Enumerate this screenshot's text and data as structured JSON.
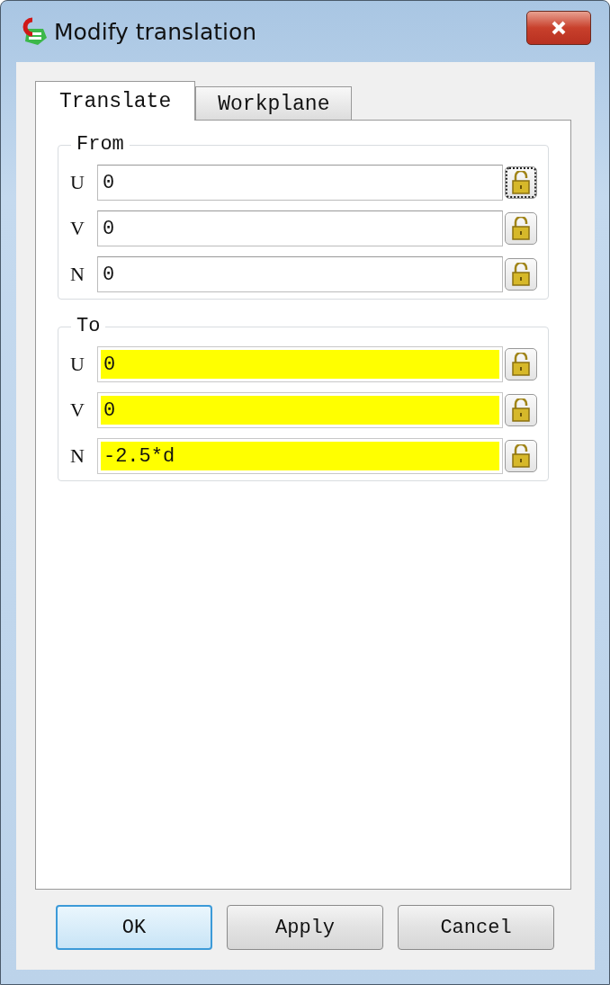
{
  "window": {
    "title": "Modify translation"
  },
  "tabs": [
    {
      "label": "Translate",
      "selected": true
    },
    {
      "label": "Workplane",
      "selected": false
    }
  ],
  "groups": [
    {
      "title": "From",
      "rows": [
        {
          "label": "U",
          "value": "0",
          "highlighted": false,
          "lock_focused": true
        },
        {
          "label": "V",
          "value": "0",
          "highlighted": false,
          "lock_focused": false
        },
        {
          "label": "N",
          "value": "0",
          "highlighted": false,
          "lock_focused": false
        }
      ]
    },
    {
      "title": "To",
      "rows": [
        {
          "label": "U",
          "value": "0",
          "highlighted": true,
          "lock_focused": false
        },
        {
          "label": "V",
          "value": "0",
          "highlighted": true,
          "lock_focused": false
        },
        {
          "label": "N",
          "value": "-2.5*d",
          "highlighted": true,
          "lock_focused": false
        }
      ]
    }
  ],
  "buttons": [
    {
      "label": "OK",
      "default": true
    },
    {
      "label": "Apply",
      "default": false
    },
    {
      "label": "Cancel",
      "default": false
    }
  ]
}
